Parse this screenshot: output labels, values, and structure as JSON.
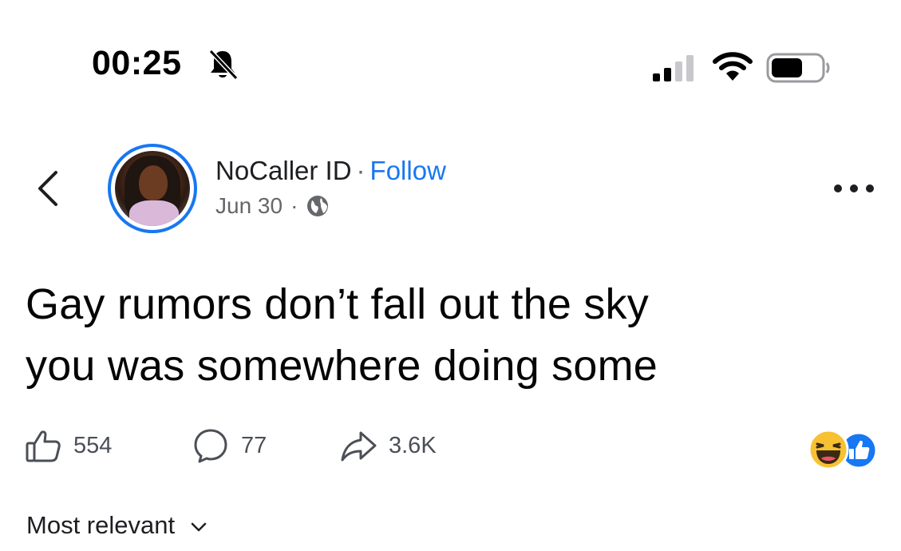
{
  "status_bar": {
    "time": "00:25",
    "icons": [
      "bell-muted-icon",
      "signal-icon",
      "wifi-icon",
      "battery-icon"
    ]
  },
  "post": {
    "author": "NoCaller ID",
    "separator": "·",
    "follow_label": "Follow",
    "date": "Jun 30",
    "audience_icon": "globe-icon",
    "text_line_1": "Gay rumors don’t fall out the sky",
    "text_line_2": "you was somewhere doing some"
  },
  "actions": {
    "likes": "554",
    "comments": "77",
    "shares": "3.6K"
  },
  "reactions": [
    "haha-icon",
    "like-badge-icon"
  ],
  "comments_section": {
    "sort_label": "Most relevant"
  },
  "colors": {
    "accent": "#1877f2",
    "text": "#050505",
    "secondary_text": "#65676b",
    "haha_yellow": "#f7c132"
  }
}
